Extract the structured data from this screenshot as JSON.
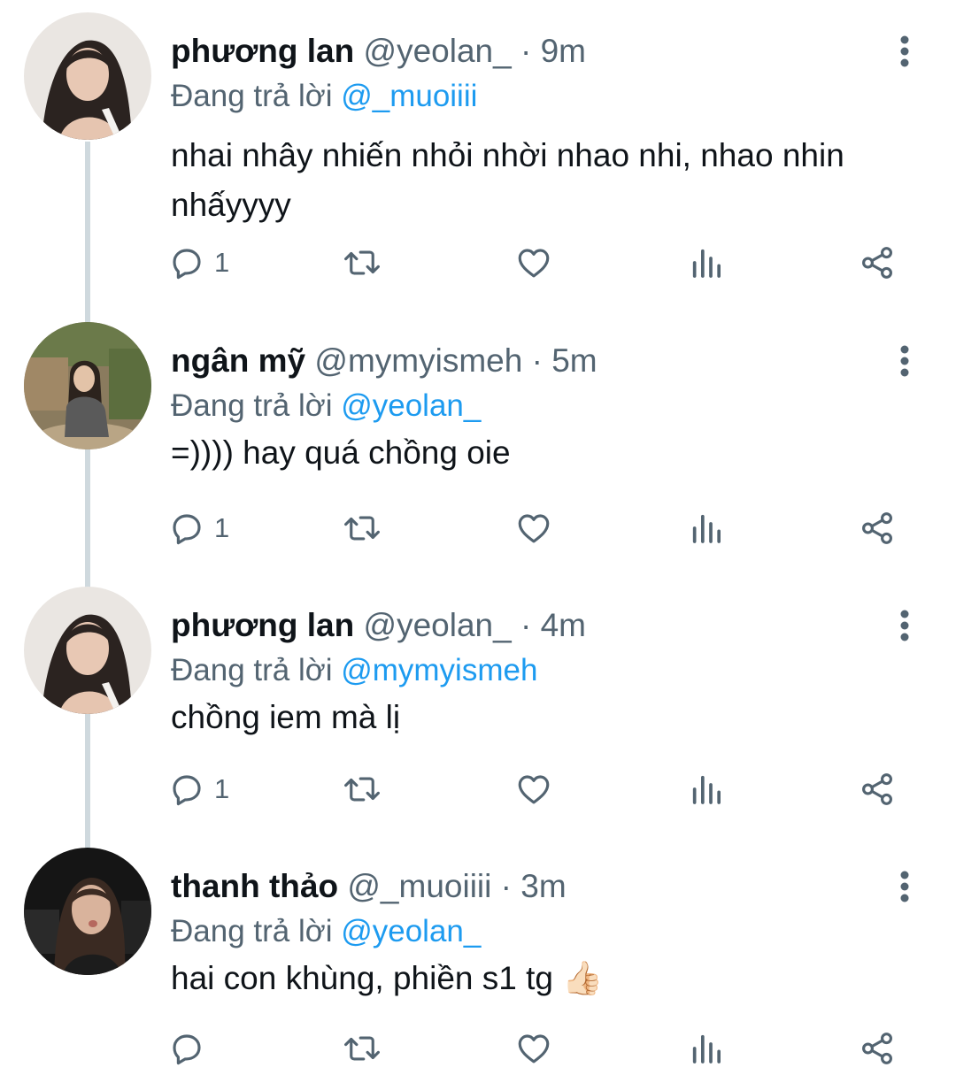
{
  "colors": {
    "text": "#0f1419",
    "secondary": "#536471",
    "link": "#1d9bf0",
    "thread_line": "#cfd9de"
  },
  "icons": {
    "more": "more-vertical-icon",
    "reply": "reply-icon",
    "retweet": "retweet-icon",
    "like": "heart-icon",
    "views": "analytics-icon",
    "share": "share-icon"
  },
  "tweets": [
    {
      "name": "phương lan",
      "handle": "@yeolan_",
      "separator": "·",
      "time": "9m",
      "reply_prefix": "Đang trả lời",
      "reply_to": "@_muoiiii",
      "text": "nhai nhây nhiến nhỏi nhời nhao nhi, nhao nhin nhấyyyy",
      "reply_count": "1"
    },
    {
      "name": "ngân mỹ",
      "handle": "@mymyismeh",
      "separator": "·",
      "time": "5m",
      "reply_prefix": "Đang trả lời",
      "reply_to": "@yeolan_",
      "text": "=)))) hay quá chồng oie",
      "reply_count": "1"
    },
    {
      "name": "phương lan",
      "handle": "@yeolan_",
      "separator": "·",
      "time": "4m",
      "reply_prefix": "Đang trả lời",
      "reply_to": "@mymyismeh",
      "text": "chồng iem mà lị",
      "reply_count": "1"
    },
    {
      "name": "thanh thảo",
      "handle": "@_muoiiii",
      "separator": "·",
      "time": "3m",
      "reply_prefix": "Đang trả lời",
      "reply_to": "@yeolan_",
      "text": "hai con khùng, phiền s1 tg 👍🏻",
      "reply_count": ""
    }
  ]
}
